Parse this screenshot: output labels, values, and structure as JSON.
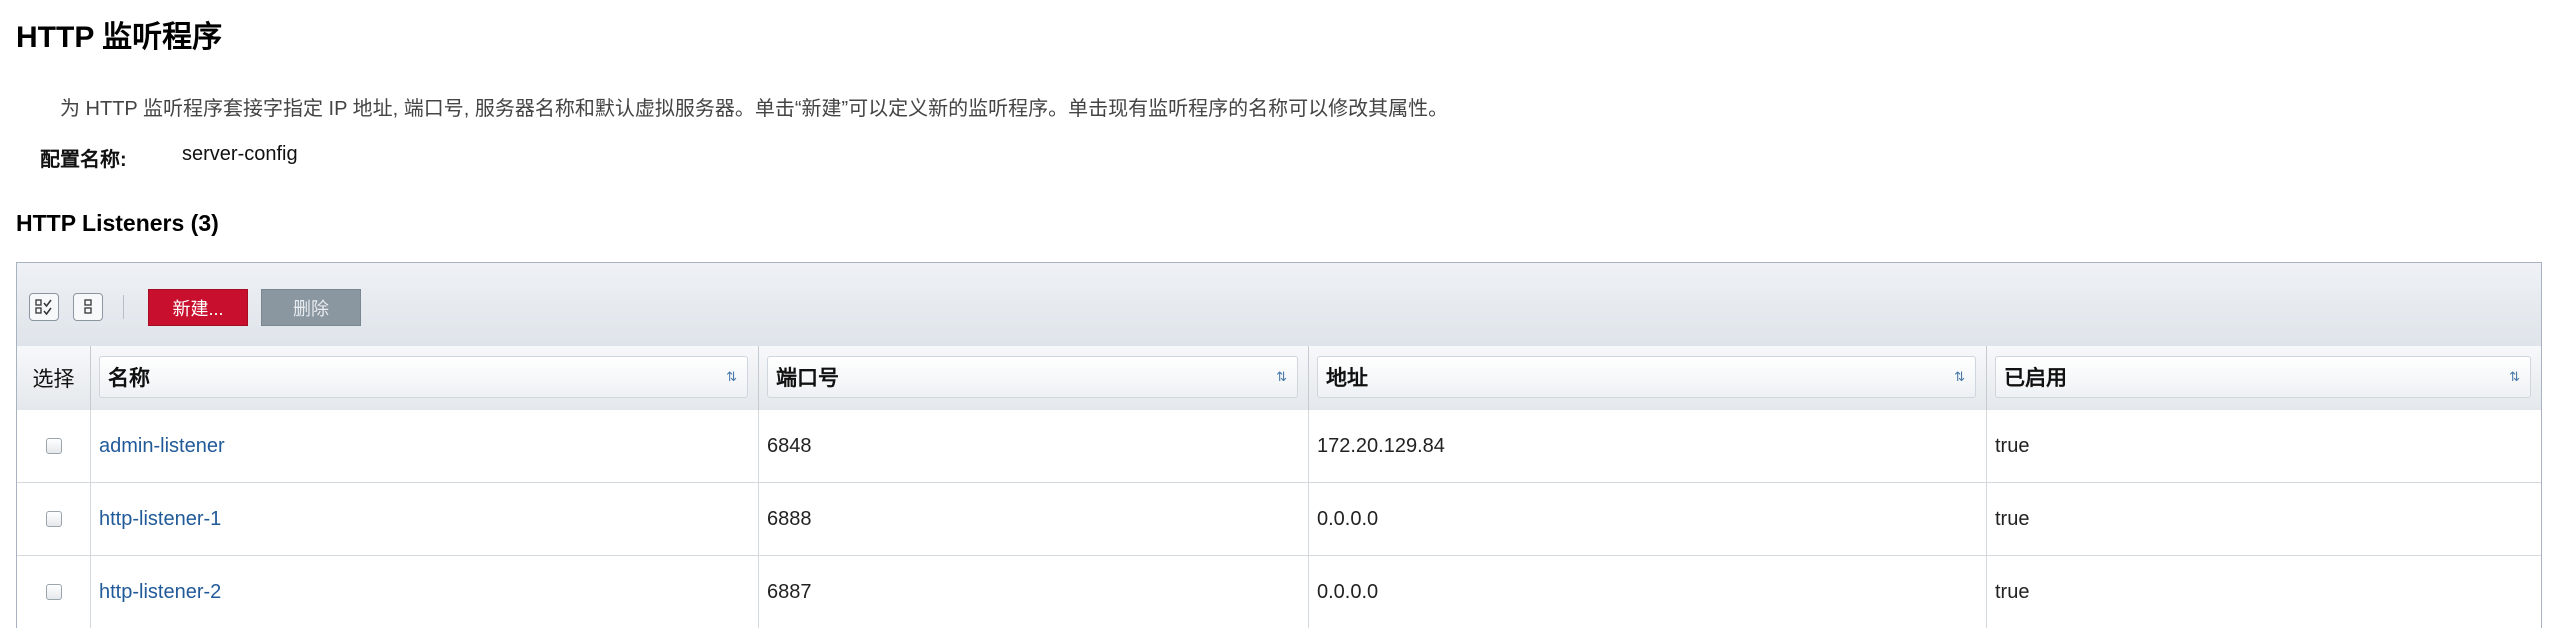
{
  "page": {
    "title": "HTTP 监听程序",
    "help_text": "为 HTTP 监听程序套接字指定 IP 地址, 端口号, 服务器名称和默认虚拟服务器。单击“新建”可以定义新的监听程序。单击现有监听程序的名称可以修改其属性。",
    "config_label": "配置名称:",
    "config_value": "server-config"
  },
  "table": {
    "title": "HTTP Listeners (3)",
    "toolbar": {
      "select_all_icon": "select-all-icon",
      "deselect_all_icon": "deselect-all-icon",
      "new_label": "新建...",
      "delete_label": "删除"
    },
    "columns": {
      "select": "选择",
      "name": "名称",
      "port": "端口号",
      "address": "地址",
      "enabled": "已启用"
    },
    "sort_icon": "⇅",
    "rows": [
      {
        "name": "admin-listener",
        "port": "6848",
        "address": "172.20.129.84",
        "enabled": "true"
      },
      {
        "name": "http-listener-1",
        "port": "6888",
        "address": "0.0.0.0",
        "enabled": "true"
      },
      {
        "name": "http-listener-2",
        "port": "6887",
        "address": "0.0.0.0",
        "enabled": "true"
      }
    ]
  },
  "colors": {
    "new_button": "#c8102e",
    "delete_button": "#8a96a0",
    "link": "#215a99"
  }
}
